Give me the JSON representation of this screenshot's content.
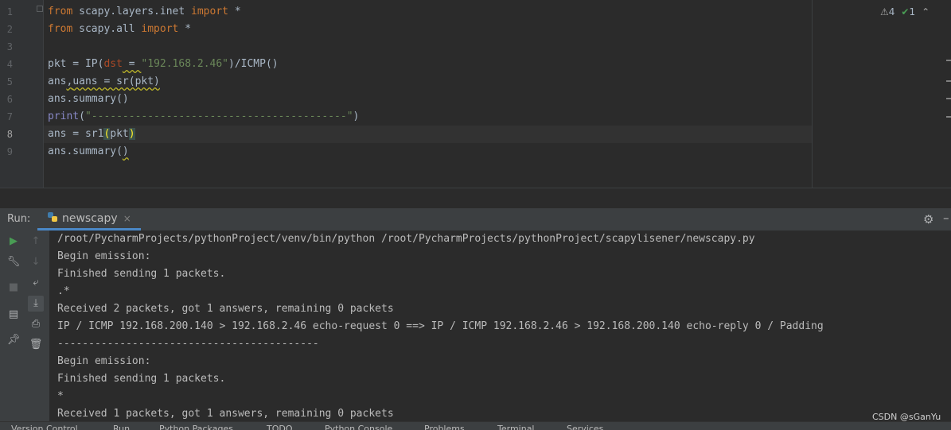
{
  "editor": {
    "line_numbers": [
      "1",
      "2",
      "3",
      "4",
      "5",
      "6",
      "7",
      "8",
      "9"
    ],
    "lines": {
      "l1": {
        "kw1": "from",
        "mid": " scapy.layers.inet ",
        "kw2": "import",
        "rest": " *"
      },
      "l2": {
        "kw1": "from",
        "mid": " scapy.all ",
        "kw2": "import",
        "rest": " *"
      },
      "l4": {
        "a": "pkt = IP(",
        "param": "dst",
        "b": " = ",
        "str": "\"192.168.2.46\"",
        "c": ")/ICMP()"
      },
      "l5": {
        "a": "ans",
        "b": ",",
        "c": "uans = sr(pkt)"
      },
      "l6": {
        "a": "ans.summary()"
      },
      "l7": {
        "fn": "print",
        "a": "(",
        "str": "\"-----------------------------------------\"",
        "b": ")"
      },
      "l8": {
        "a": "ans = sr1",
        "b": "(",
        "c": "pkt",
        "d": ")"
      },
      "l9": {
        "a": "ans.summary(",
        "b": ")"
      }
    },
    "inspections": {
      "warnings": "4",
      "weak_warnings": "1"
    }
  },
  "run": {
    "label": "Run:",
    "tab_name": "newscapy",
    "tab_close": "×",
    "output": [
      "/root/PycharmProjects/pythonProject/venv/bin/python /root/PycharmProjects/pythonProject/scapylisener/newscapy.py",
      "Begin emission:",
      "Finished sending 1 packets.",
      ".*",
      "Received 2 packets, got 1 answers, remaining 0 packets",
      "IP / ICMP 192.168.200.140 > 192.168.2.46 echo-request 0 ==> IP / ICMP 192.168.2.46 > 192.168.200.140 echo-reply 0 / Padding",
      "------------------------------------------",
      "Begin emission:",
      "Finished sending 1 packets.",
      "*",
      "Received 1 packets, got 1 answers, remaining 0 packets"
    ]
  },
  "bottom_tabs": [
    "Version Control",
    "Run",
    "Python Packages",
    "TODO",
    "Python Console",
    "Problems",
    "Terminal",
    "Services"
  ],
  "watermark": "CSDN @sGanYu",
  "colors": {
    "keyword": "#cc7832",
    "string": "#6a8759",
    "param": "#aa4926",
    "builtin": "#8888c6",
    "run_accent": "#4a88c7",
    "run_green": "#499c54"
  }
}
